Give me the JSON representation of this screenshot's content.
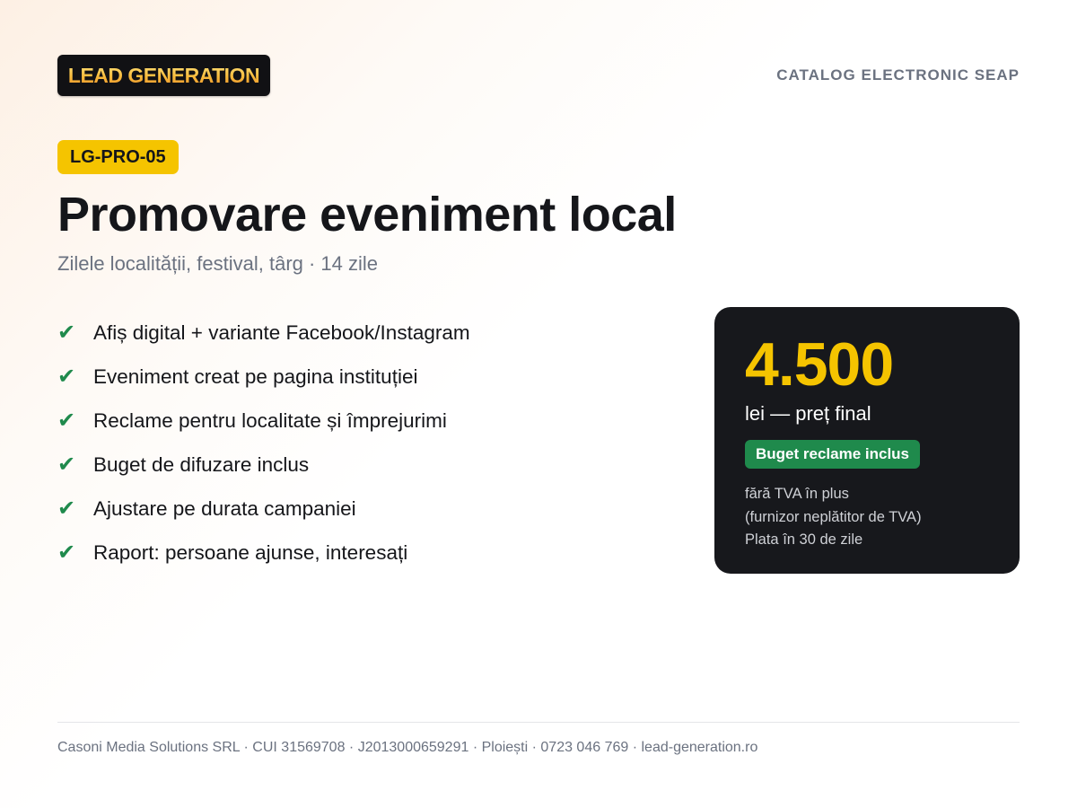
{
  "header": {
    "logo_text": "LEAD GENERATION",
    "catalog_label": "CATALOG ELECTRONIC SEAP"
  },
  "product": {
    "code": "LG-PRO-05",
    "title": "Promovare eveniment local",
    "subtitle": "Zilele localității, festival, târg · 14 zile",
    "features": [
      "Afiș digital + variante Facebook/Instagram",
      "Eveniment creat pe pagina instituției",
      "Reclame pentru localitate și împrejurimi",
      "Buget de difuzare inclus",
      "Ajustare pe durata campaniei",
      "Raport: persoane ajunse, interesați"
    ],
    "check_icon": "check-icon"
  },
  "pricing": {
    "price": "4.500",
    "price_label": "lei — preț final",
    "badge": "Buget reclame inclus",
    "notes": [
      "fără TVA în plus",
      "(furnizor neplătitor de TVA)",
      "Plata în 30 de zile"
    ]
  },
  "footer": {
    "text": "Casoni Media Solutions SRL · CUI 31569708 · J2013000659291 · Ploiești · 0723 046 769 · lead-generation.ro"
  },
  "colors": {
    "accent_yellow": "#f5c400",
    "card_dark": "#17181c",
    "check_green": "#1f8a4c",
    "muted_gray": "#6b7280"
  }
}
